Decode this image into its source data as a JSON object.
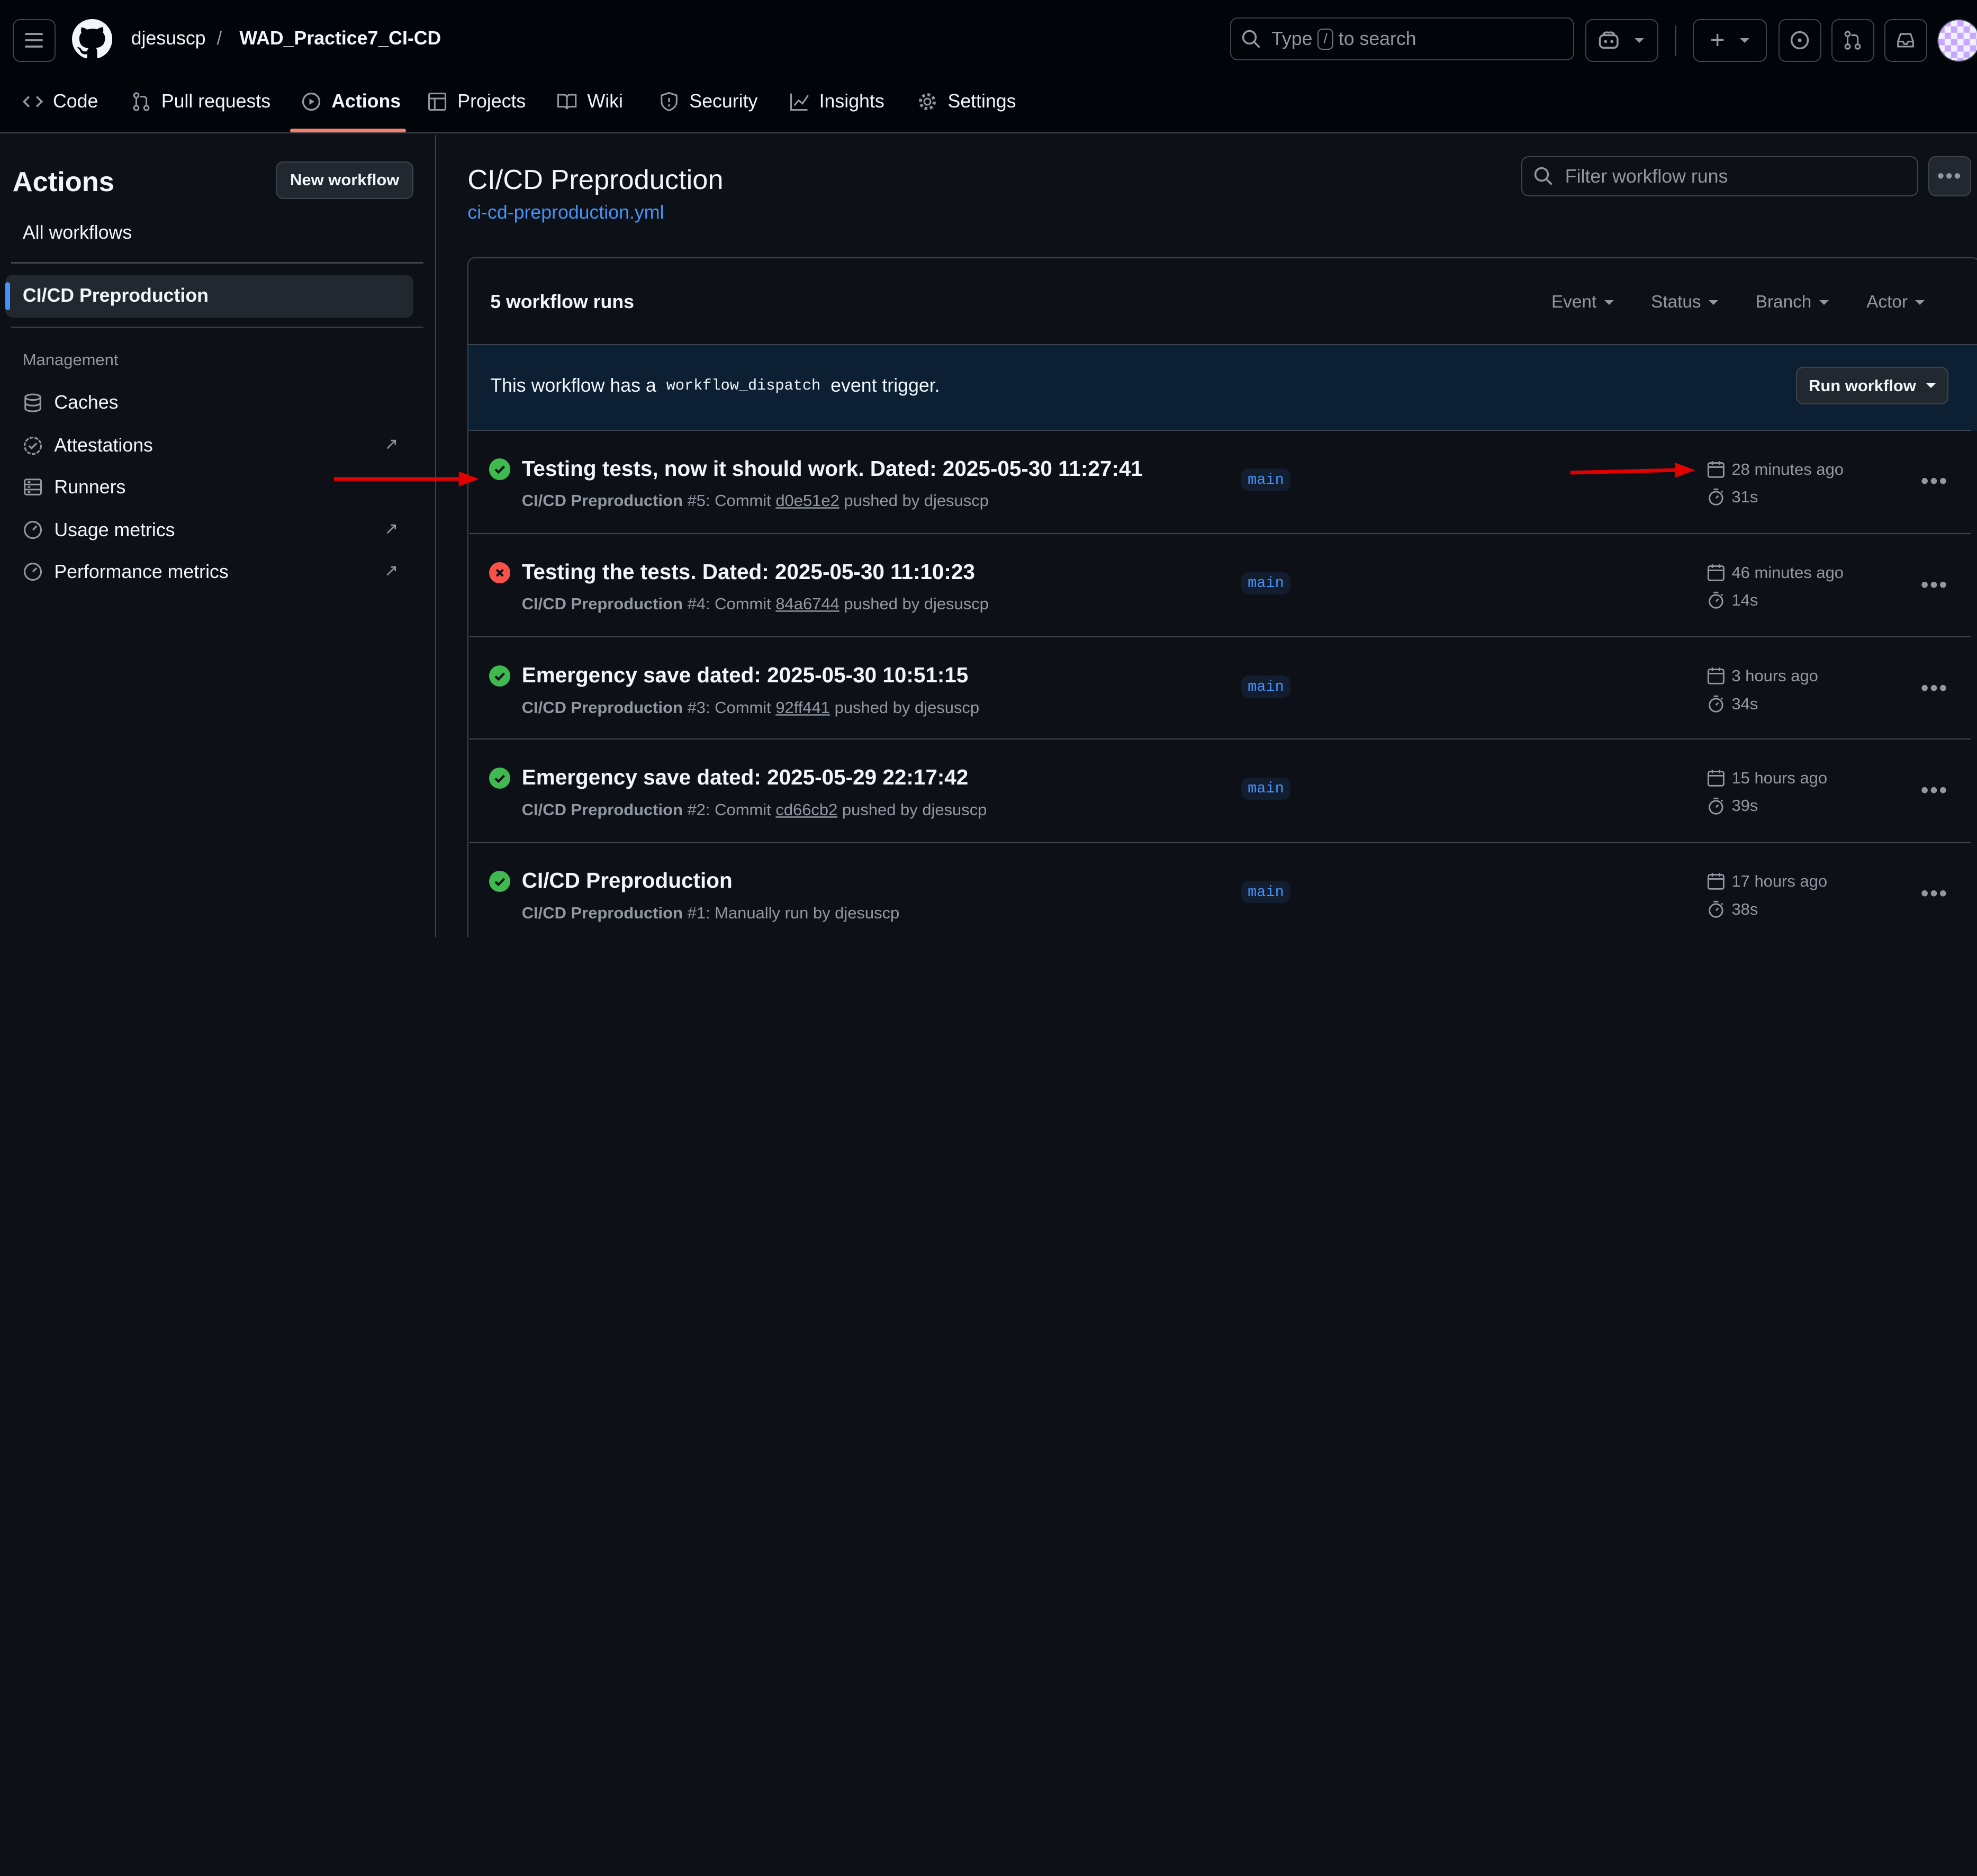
{
  "header": {
    "owner": "djesuscp",
    "separator": "/",
    "repo": "WAD_Practice7_CI-CD",
    "search_pre": "Type",
    "search_key": "/",
    "search_post": "to search",
    "plus": "+"
  },
  "nav": [
    {
      "label": "Code",
      "icon": "code-icon"
    },
    {
      "label": "Pull requests",
      "icon": "pull-request-icon"
    },
    {
      "label": "Actions",
      "icon": "play-icon"
    },
    {
      "label": "Projects",
      "icon": "table-icon"
    },
    {
      "label": "Wiki",
      "icon": "book-icon"
    },
    {
      "label": "Security",
      "icon": "shield-icon"
    },
    {
      "label": "Insights",
      "icon": "graph-icon"
    },
    {
      "label": "Settings",
      "icon": "gear-icon"
    }
  ],
  "sidebar": {
    "title": "Actions",
    "new_workflow": "New workflow",
    "all_workflows": "All workflows",
    "selected": "CI/CD Preproduction",
    "section": "Management",
    "items": [
      {
        "label": "Caches",
        "icon": "database-icon",
        "external": false
      },
      {
        "label": "Attestations",
        "icon": "verified-icon",
        "external": true
      },
      {
        "label": "Runners",
        "icon": "server-icon",
        "external": false
      },
      {
        "label": "Usage metrics",
        "icon": "meter-icon",
        "external": true
      },
      {
        "label": "Performance metrics",
        "icon": "meter-icon",
        "external": true
      }
    ]
  },
  "main": {
    "title": "CI/CD Preproduction",
    "file": "ci-cd-preproduction.yml",
    "filter_placeholder": "Filter workflow runs",
    "runs_count": "5 workflow runs",
    "filters": [
      "Event",
      "Status",
      "Branch",
      "Actor"
    ],
    "dispatch_pre": "This workflow has a",
    "dispatch_code": "workflow_dispatch",
    "dispatch_post": "event trigger.",
    "run_workflow": "Run workflow"
  },
  "runs": [
    {
      "title": "Testing tests, now it should work. Dated: 2025-05-30 11:27:41",
      "workflow": "CI/CD Preproduction",
      "number": "#5: Commit",
      "commit": "d0e51e2",
      "by": "pushed by djesuscp",
      "branch": "main",
      "when": "28 minutes ago",
      "duration": "31s",
      "status": "success"
    },
    {
      "title": "Testing the tests. Dated: 2025-05-30 11:10:23",
      "workflow": "CI/CD Preproduction",
      "number": "#4: Commit",
      "commit": "84a6744",
      "by": "pushed by djesuscp",
      "branch": "main",
      "when": "46 minutes ago",
      "duration": "14s",
      "status": "failure"
    },
    {
      "title": "Emergency save dated: 2025-05-30 10:51:15",
      "workflow": "CI/CD Preproduction",
      "number": "#3: Commit",
      "commit": "92ff441",
      "by": "pushed by djesuscp",
      "branch": "main",
      "when": "3 hours ago",
      "duration": "34s",
      "status": "success"
    },
    {
      "title": "Emergency save dated: 2025-05-29 22:17:42",
      "workflow": "CI/CD Preproduction",
      "number": "#2: Commit",
      "commit": "cd66cb2",
      "by": "pushed by djesuscp",
      "branch": "main",
      "when": "15 hours ago",
      "duration": "39s",
      "status": "success"
    },
    {
      "title": "CI/CD Preproduction",
      "workflow": "CI/CD Preproduction",
      "number": "#1: Manually run by djesuscp",
      "commit": "",
      "by": "",
      "branch": "main",
      "when": "17 hours ago",
      "duration": "38s",
      "status": "success"
    }
  ],
  "annotations": {
    "arrow_color": "#e00000"
  }
}
